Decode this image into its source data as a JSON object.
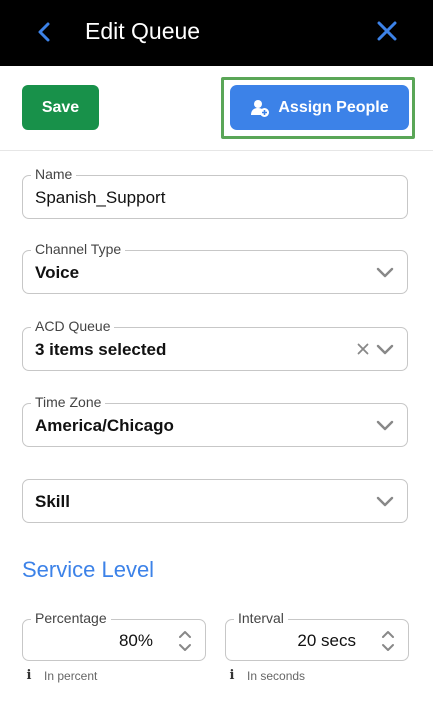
{
  "header": {
    "title": "Edit Queue",
    "back_icon": "chevron-left-icon",
    "close_icon": "close-icon",
    "accent": "#3c82e8"
  },
  "actions": {
    "save_label": "Save",
    "assign_label": "Assign People",
    "assign_icon": "user-add-icon",
    "save_color": "#18914a",
    "assign_color": "#3c82e8",
    "highlight_color": "#5aa657"
  },
  "form": {
    "name": {
      "label": "Name",
      "value": "Spanish_Support"
    },
    "channel_type": {
      "label": "Channel Type",
      "value": "Voice"
    },
    "acd_queue": {
      "label": "ACD Queue",
      "value": "3 items selected"
    },
    "time_zone": {
      "label": "Time Zone",
      "value": "America/Chicago"
    },
    "skill": {
      "value": "Skill"
    }
  },
  "service_level": {
    "title": "Service Level",
    "percentage": {
      "label": "Percentage",
      "value": "80%",
      "hint": "In percent"
    },
    "interval": {
      "label": "Interval",
      "value": "20 secs",
      "hint": "In seconds"
    }
  }
}
